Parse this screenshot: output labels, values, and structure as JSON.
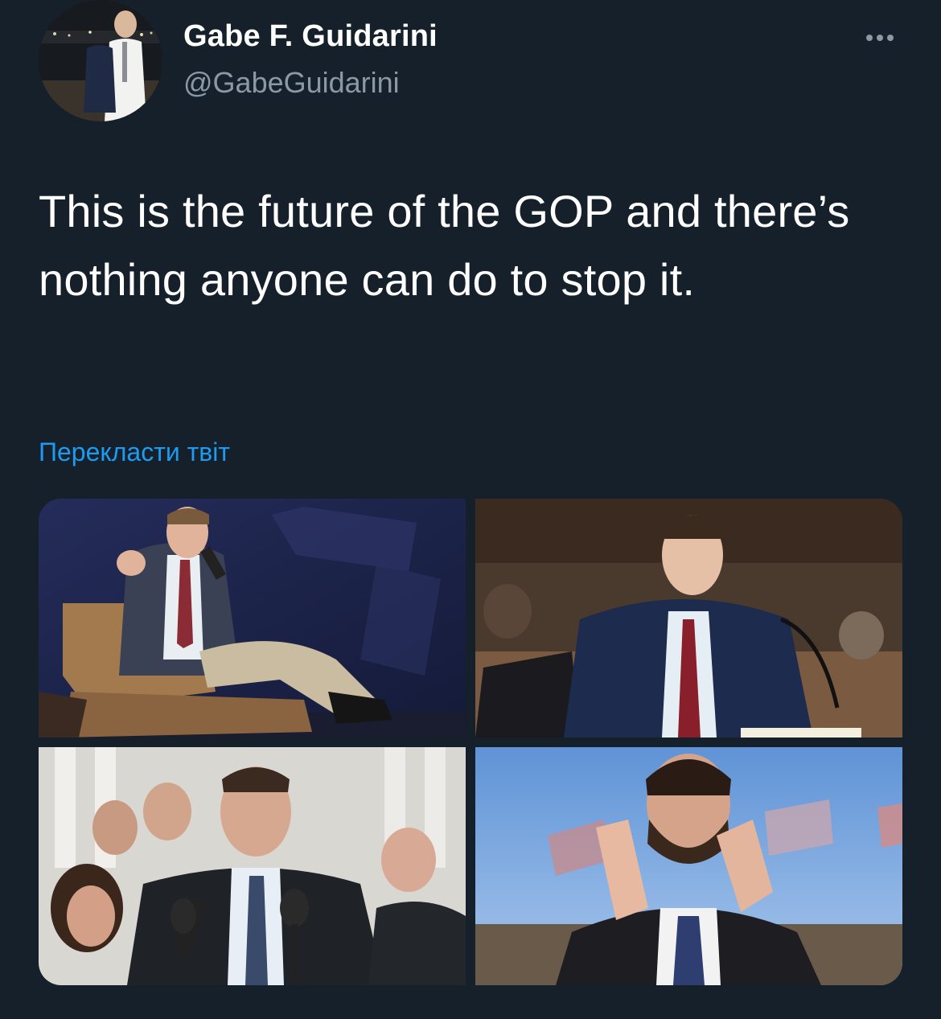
{
  "author": {
    "display_name": "Gabe F. Guidarini",
    "handle": "@GabeGuidarini"
  },
  "tweet": {
    "text": "This is the future of the GOP and there’s nothing anyone can do to stop it.",
    "translate_label": "Перекласти твіт"
  },
  "media": {
    "photo_count": 4,
    "photo_1": {
      "subject": "man in armchair holding microphone on stage"
    },
    "photo_2": {
      "subject": "man in suit seated at hearing table with microphone"
    },
    "photo_3": {
      "subject": "man speaking at microphones in front of crowd"
    },
    "photo_4": {
      "subject": "bearded man clapping with flags behind"
    }
  },
  "colors": {
    "background": "#15202b",
    "text_primary": "#ffffff",
    "text_secondary": "#8b98a5",
    "link": "#1d9bf0"
  },
  "icons": {
    "more": "more-horizontal-icon"
  }
}
